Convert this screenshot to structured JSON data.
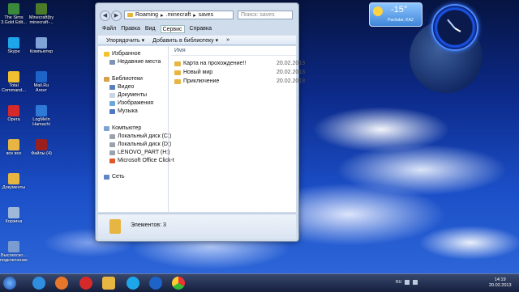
{
  "desktop": {
    "icons_left": [
      {
        "label": "The Sims 3.Gold Edit...",
        "icon": "game-icon",
        "color": "#3b8a3b"
      },
      {
        "label": "Skype",
        "icon": "skype-icon",
        "color": "#1ea6ea"
      },
      {
        "label": "Total Command...",
        "icon": "total-commander-icon",
        "color": "#f0c030"
      },
      {
        "label": "Opera",
        "icon": "opera-icon",
        "color": "#d62a2a"
      },
      {
        "label": "все все",
        "icon": "document-icon",
        "color": "#e7b542"
      },
      {
        "label": "Документы",
        "icon": "documents-icon",
        "color": "#e7b542"
      },
      {
        "label": "Корзина",
        "icon": "recycle-bin-icon",
        "color": "#9fb7d9"
      },
      {
        "label": "Высокоско... подключение",
        "icon": "network-icon",
        "color": "#7a9cd0"
      }
    ],
    "icons_col2": [
      {
        "label": "Minecraft(by minecraft-...",
        "icon": "minecraft-icon",
        "color": "#4a7a2a"
      },
      {
        "label": "Компьютер",
        "icon": "computer-icon",
        "color": "#7fa3d6"
      },
      {
        "label": "Mail.Ru Агент",
        "icon": "mailru-agent-icon",
        "color": "#1e63c8"
      },
      {
        "label": "LogMeIn Hamachi",
        "icon": "hamachi-icon",
        "color": "#2f7ad6"
      },
      {
        "label": "Файлы (4)",
        "icon": "files-icon",
        "color": "#9a2020"
      }
    ]
  },
  "window": {
    "address": {
      "crumbs": [
        "Roaming",
        ".minecraft",
        "saves"
      ],
      "search_placeholder": "Поиск: saves"
    },
    "menu": [
      "Файл",
      "Правка",
      "Вид",
      "Сервис",
      "Справка"
    ],
    "toolbar": {
      "organize": "Упорядочить ▾",
      "add_to_library": "Добавить в библиотеку ▾",
      "more": "»"
    },
    "nav": {
      "favorites": "Избранное",
      "recent": "Недавние места",
      "libraries": "Библиотеки",
      "video": "Видео",
      "documents": "Документы",
      "images": "Изображения",
      "music": "Музыка",
      "computer": "Компьютер",
      "disk_c": "Локальный диск (C:)",
      "disk_d": "Локальный диск (D:)",
      "lenovo": "LENOVO_PART (H:)",
      "office": "Microsoft Office Click-t",
      "network": "Сеть"
    },
    "column_name": "Имя",
    "files": [
      {
        "name": "Карта на прохождение!!",
        "date": "20.02.2013"
      },
      {
        "name": "Новый мир",
        "date": "20.02.2013"
      },
      {
        "name": "Приключение",
        "date": "20.02.2013"
      }
    ],
    "status": "Элементов: 3"
  },
  "gadgets": {
    "temperature": "-15°",
    "city": "Pavlodar, KAZ"
  },
  "taskbar": {
    "lang": "RU",
    "time": "14:19",
    "date": "20.02.2013"
  }
}
